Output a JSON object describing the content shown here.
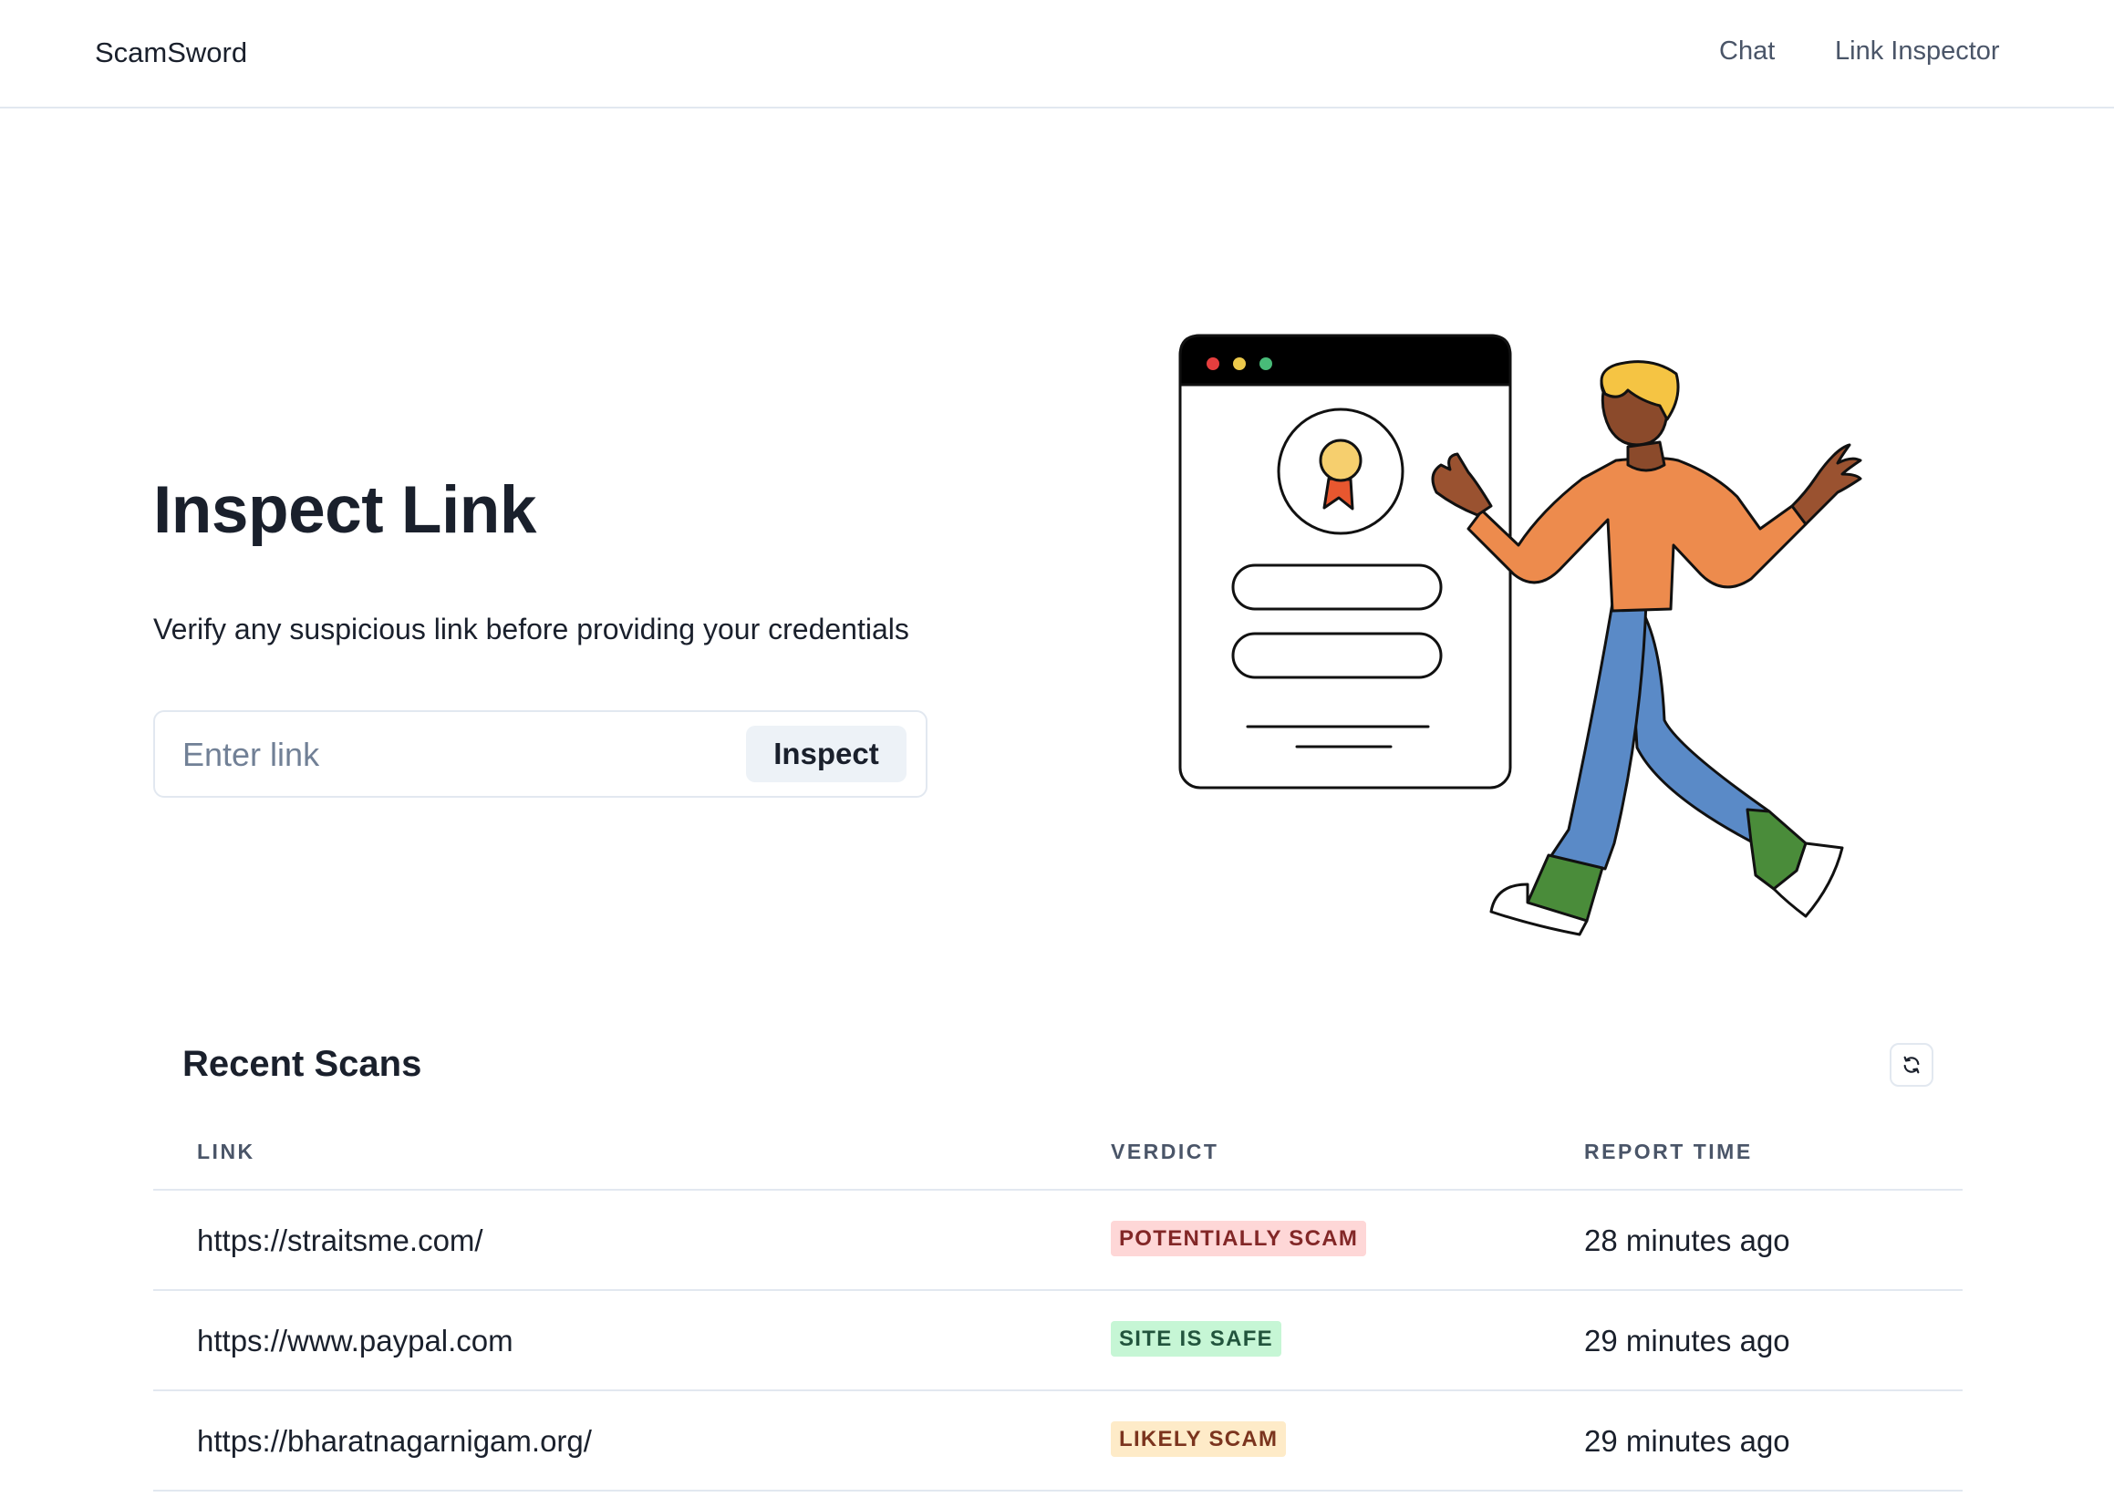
{
  "navbar": {
    "brand": "ScamSword",
    "links": [
      "Chat",
      "Link Inspector"
    ]
  },
  "hero": {
    "title": "Inspect Link",
    "subtitle": "Verify any suspicious link before providing your credentials",
    "input_placeholder": "Enter link",
    "input_value": "",
    "button_label": "Inspect"
  },
  "recent_scans": {
    "title": "Recent Scans",
    "columns": [
      "LINK",
      "VERDICT",
      "REPORT TIME"
    ],
    "rows": [
      {
        "link": "https://straitsme.com/",
        "verdict": "POTENTIALLY SCAM",
        "time": "28 minutes ago"
      },
      {
        "link": "https://www.paypal.com",
        "verdict": "SITE IS SAFE",
        "time": "29 minutes ago"
      },
      {
        "link": "https://bharatnagarnigam.org/",
        "verdict": "LIKELY SCAM",
        "time": "29 minutes ago"
      }
    ]
  },
  "verdict_colors": {
    "POTENTIALLY SCAM": {
      "bg": "#fed7d7",
      "fg": "#822727"
    },
    "SITE IS SAFE": {
      "bg": "#c6f6d5",
      "fg": "#22543d"
    },
    "LIKELY SCAM": {
      "bg": "#feebc8",
      "fg": "#7b341e"
    }
  },
  "icons": {
    "refresh": "refresh-icon",
    "illustration": "person-certificate-illustration"
  }
}
